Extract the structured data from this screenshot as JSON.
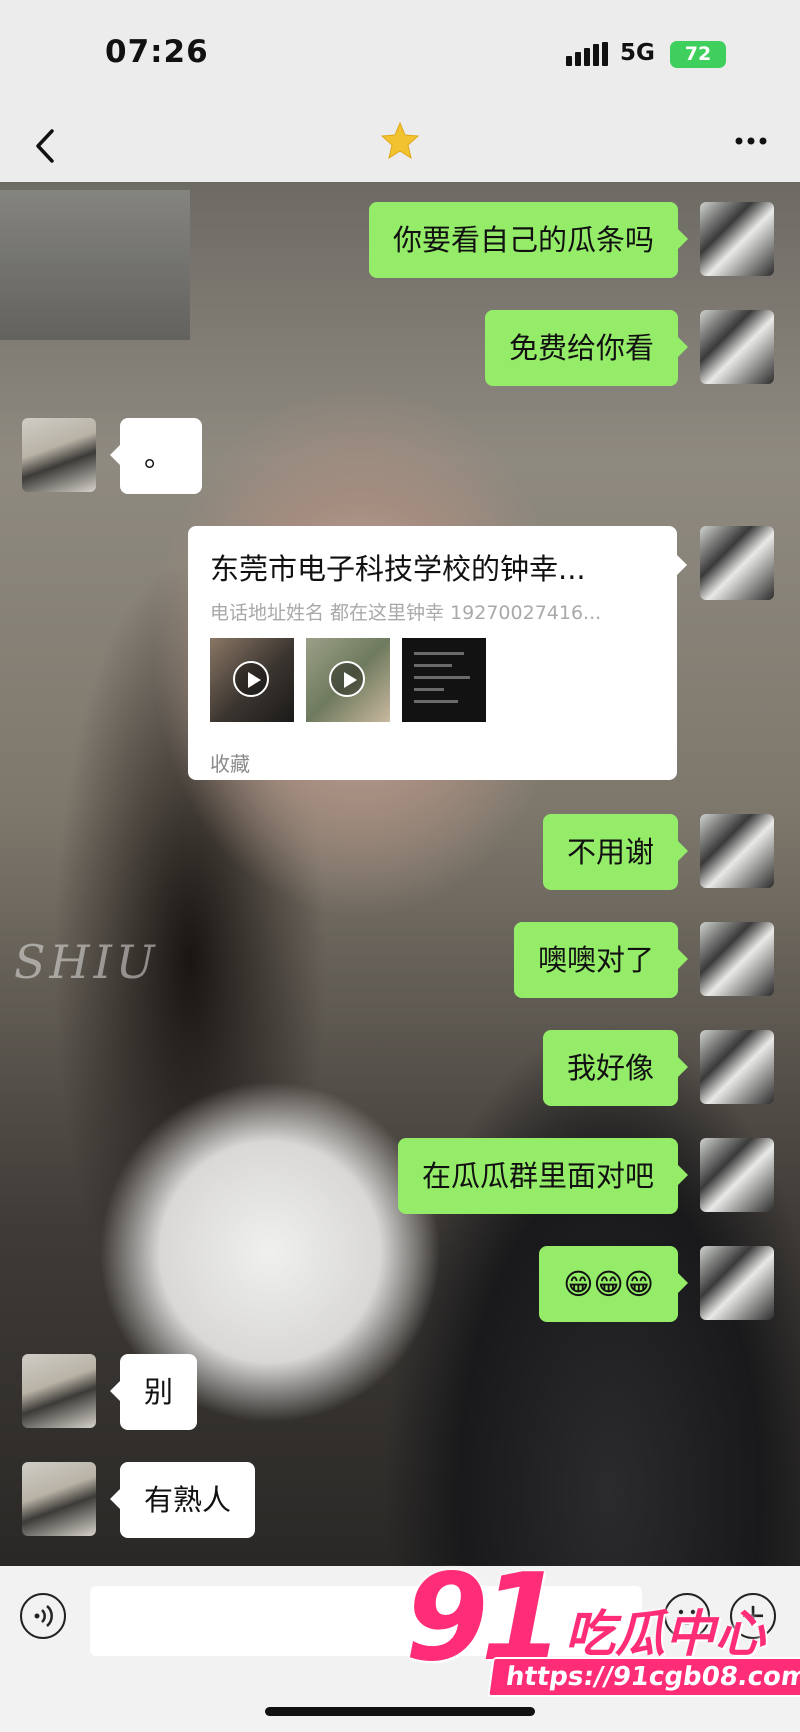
{
  "status_bar": {
    "time": "07:26",
    "network": "5G",
    "battery": "72"
  },
  "nav": {
    "back_icon": "chevron-left-icon",
    "title_icon": "star-icon",
    "more_icon": "more-dots-icon",
    "more_label": "..."
  },
  "messages": [
    {
      "from": "me",
      "text": "你要看自己的瓜条吗"
    },
    {
      "from": "me",
      "text": "免费给你看"
    },
    {
      "from": "them",
      "text": "。"
    },
    {
      "from": "me",
      "type": "card"
    },
    {
      "from": "me",
      "text": "不用谢"
    },
    {
      "from": "me",
      "text": "噢噢对了"
    },
    {
      "from": "me",
      "text": "我好像"
    },
    {
      "from": "me",
      "text": "在瓜瓜群里面对吧"
    },
    {
      "from": "me",
      "text": "😁😁😁"
    },
    {
      "from": "them",
      "text": "别"
    },
    {
      "from": "them",
      "text": "有熟人"
    }
  ],
  "card": {
    "title": "东莞市电子科技学校的钟幸...",
    "subtitle": "电话地址姓名 都在这里钟幸 19270027416...",
    "footer": "收藏"
  },
  "wallpaper_text": "SHIU",
  "input_bar": {
    "voice_icon": "voice-icon",
    "emoji_icon": "emoji-icon",
    "plus_icon": "plus-icon",
    "plus_label": "+"
  },
  "watermark": {
    "logo": "91",
    "brand": "吃瓜中心",
    "url": "https://91cgb08.com"
  },
  "colors": {
    "my_bubble": "#95ec69",
    "their_bubble": "#ffffff",
    "brand_pink": "#ff2d78",
    "battery": "#3fcf5d"
  }
}
